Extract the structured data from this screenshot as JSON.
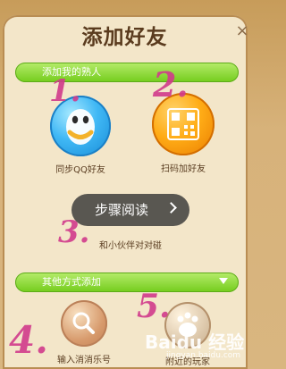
{
  "header": {
    "title": "添加好友",
    "close_label": "×"
  },
  "section_acquaintances": {
    "label": "添加我的熟人"
  },
  "items_top": [
    {
      "label": "同步QQ好友",
      "icon": "qq-penguin-icon"
    },
    {
      "label": "扫码加好友",
      "icon": "qr-code-icon"
    }
  ],
  "step_overlay": {
    "label": "步骤阅读",
    "arrow": "chevron-right-icon"
  },
  "item_bump": {
    "label": "和小伙伴对对碰"
  },
  "section_other": {
    "label": "其他方式添加"
  },
  "items_bottom": [
    {
      "label": "输入消消乐号",
      "icon": "search-icon"
    },
    {
      "label": "附近的玩家",
      "icon": "baidu-icon"
    }
  ],
  "annotations": [
    "1.",
    "2.",
    "3.",
    "4.",
    "5."
  ],
  "watermark": {
    "line1": "Baidu 经验",
    "line2": "jingyan.baidu.com"
  }
}
